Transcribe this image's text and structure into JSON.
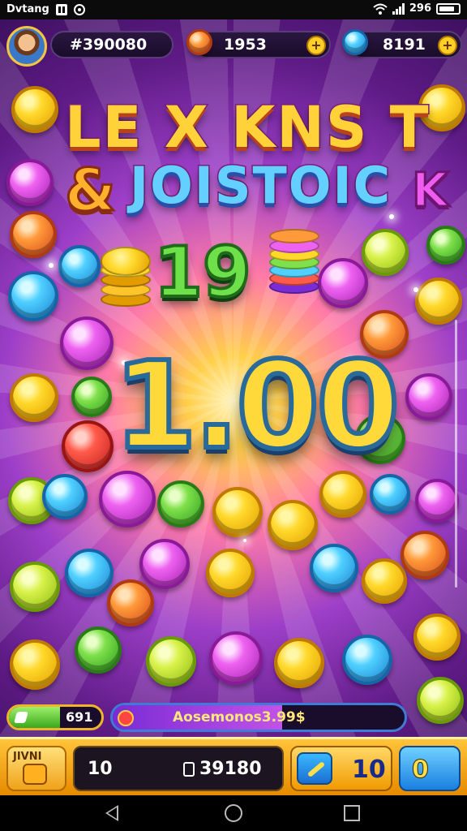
{
  "status_bar": {
    "carrier": "Dvtang",
    "battery_text": "296"
  },
  "top_bar": {
    "score": "#390080",
    "coins": "1953",
    "gems": "8191",
    "plus_label": "+"
  },
  "title": {
    "line1": "LE X KNS T",
    "amp": "&",
    "line2": "JOISTOIC",
    "k": "K"
  },
  "combo_value": "19",
  "multiplier": "1.00",
  "progress": {
    "left_value": "691",
    "left_fraction": 0.55,
    "main_label": "Aosemonos3.99$",
    "main_fraction": 0.58
  },
  "bottom_bar": {
    "left_label": "JIVNI",
    "bet": "10",
    "balance": "39180",
    "sword_value": "10",
    "blue_value": "0"
  },
  "colors": {
    "background": "#5f1b86",
    "accent_gold": "#ffd83a",
    "accent_blue": "#3f7ad6"
  },
  "icons": [
    "pause-icon",
    "record-icon",
    "wifi-icon",
    "signal-icon",
    "battery-icon",
    "avatar-icon",
    "coin-icon",
    "gem-icon",
    "plus-icon",
    "sword-icon",
    "back-icon",
    "home-icon",
    "recents-icon"
  ]
}
